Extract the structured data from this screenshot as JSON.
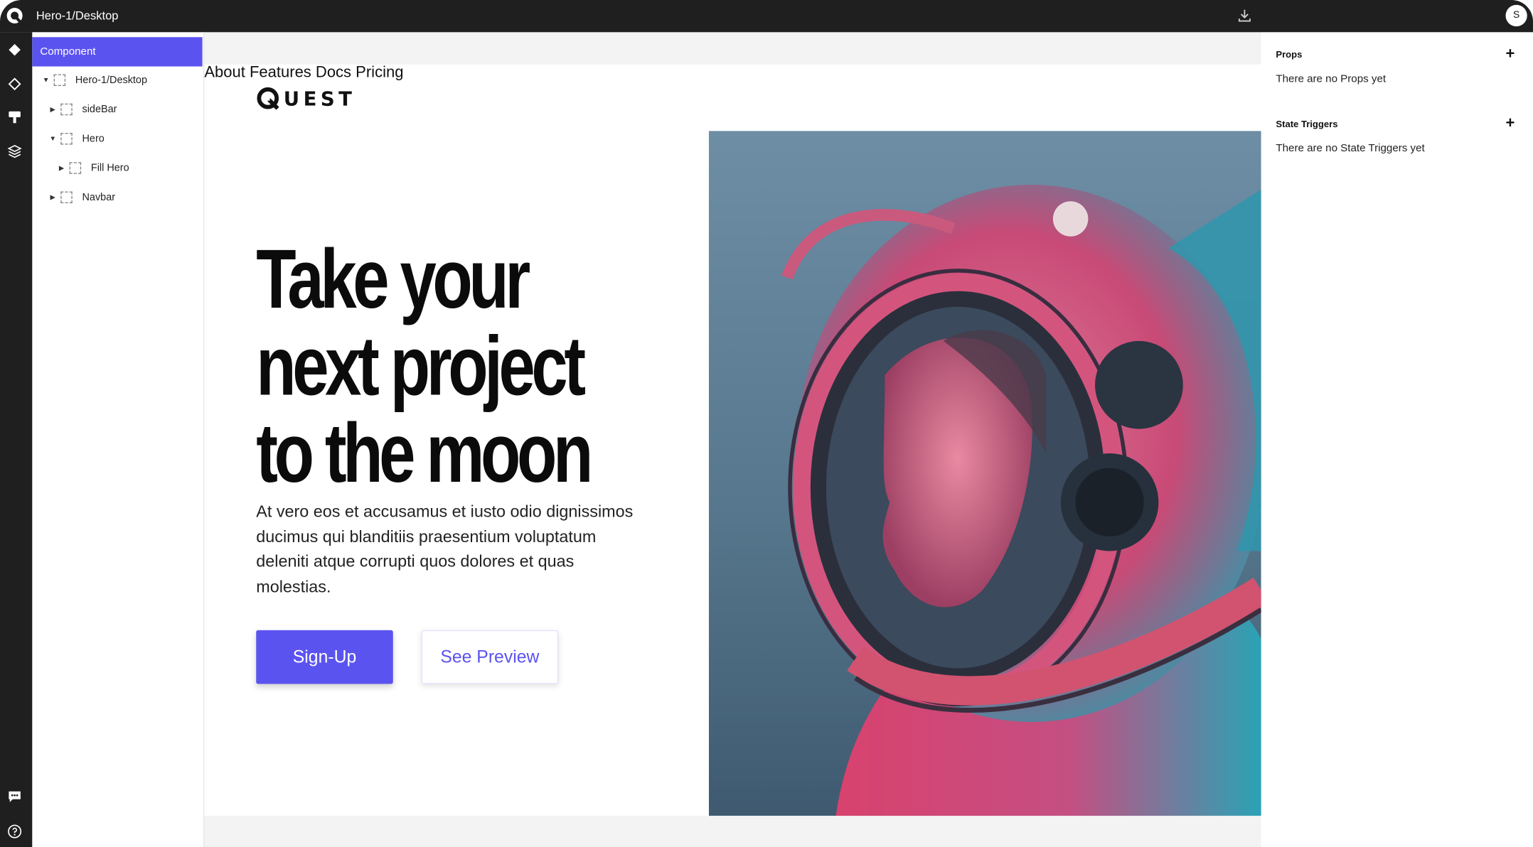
{
  "window": {
    "title": "Hero-1/Desktop",
    "user_initial": "S"
  },
  "icons": {
    "app_logo": "app-logo-icon",
    "download": "download-icon",
    "rail": [
      "component-icon",
      "diamond-outline-icon",
      "paint-roller-icon",
      "layers-icon",
      "chat-icon",
      "help-icon"
    ]
  },
  "layers": {
    "header": "Component",
    "items": [
      {
        "label": "Hero-1/Desktop",
        "expanded": true,
        "depth": 0
      },
      {
        "label": "sideBar",
        "expanded": false,
        "depth": 1
      },
      {
        "label": "Hero",
        "expanded": true,
        "depth": 1
      },
      {
        "label": "Fill Hero",
        "expanded": false,
        "depth": 2
      },
      {
        "label": "Navbar",
        "expanded": false,
        "depth": 1
      }
    ]
  },
  "page": {
    "brand": "UEST",
    "nav": [
      "About",
      "Features",
      "Docs",
      "Pricing"
    ],
    "headline": [
      "Take your",
      "next project",
      "to the moon"
    ],
    "paragraph": "At vero eos et accusamus et iusto odio dignissimos ducimus qui blanditiis praesentium voluptatum deleniti atque corrupti quos dolores et quas molestias.",
    "primary_button": "Sign-Up",
    "secondary_button": "See Preview",
    "hero_image": "astronaut-helmet-portrait"
  },
  "props_panel": {
    "props_title": "Props",
    "props_empty": "There are no Props yet",
    "triggers_title": "State Triggers",
    "triggers_empty": "There are no State Triggers yet"
  },
  "colors": {
    "accent": "#5b53f0",
    "chrome": "#1f1f1f",
    "canvas_bg": "#f3f3f3"
  }
}
